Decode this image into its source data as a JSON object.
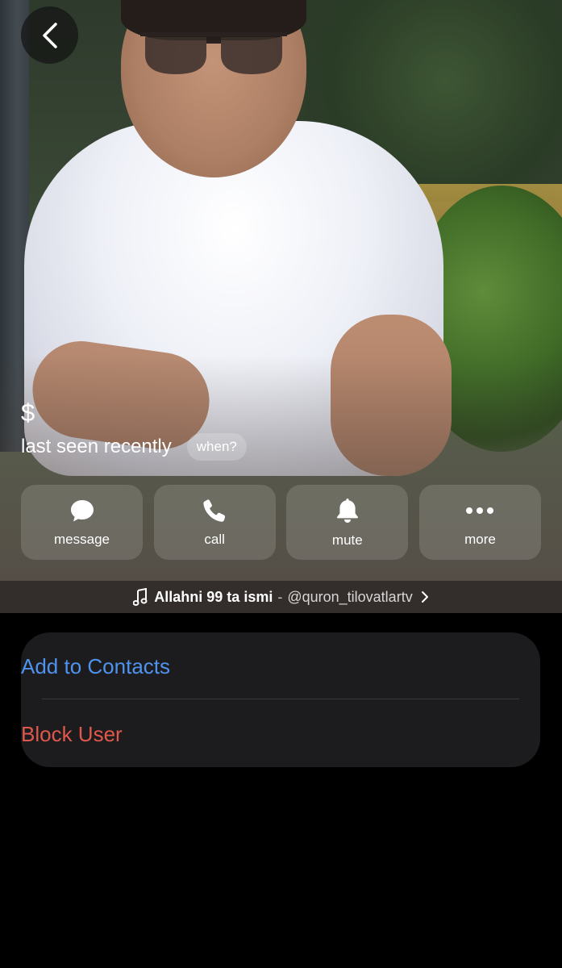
{
  "profile": {
    "name": "$",
    "status": "last seen recently",
    "when_label": "when?"
  },
  "actions": [
    {
      "label": "message",
      "icon": "message-bubble-icon"
    },
    {
      "label": "call",
      "icon": "phone-icon"
    },
    {
      "label": "mute",
      "icon": "bell-icon"
    },
    {
      "label": "more",
      "icon": "ellipsis-icon"
    }
  ],
  "music": {
    "icon": "music-note-icon",
    "title": "Allahni 99 ta ismi",
    "separator": "-",
    "channel": "@quron_tilovatlartv",
    "chevron": "chevron-right-icon"
  },
  "menu": {
    "add_contact": "Add to Contacts",
    "block_user": "Block User"
  },
  "colors": {
    "background": "#000000",
    "card": "#1c1c1e",
    "link_blue": "#4e93ee",
    "destructive_red": "#e0584b"
  }
}
